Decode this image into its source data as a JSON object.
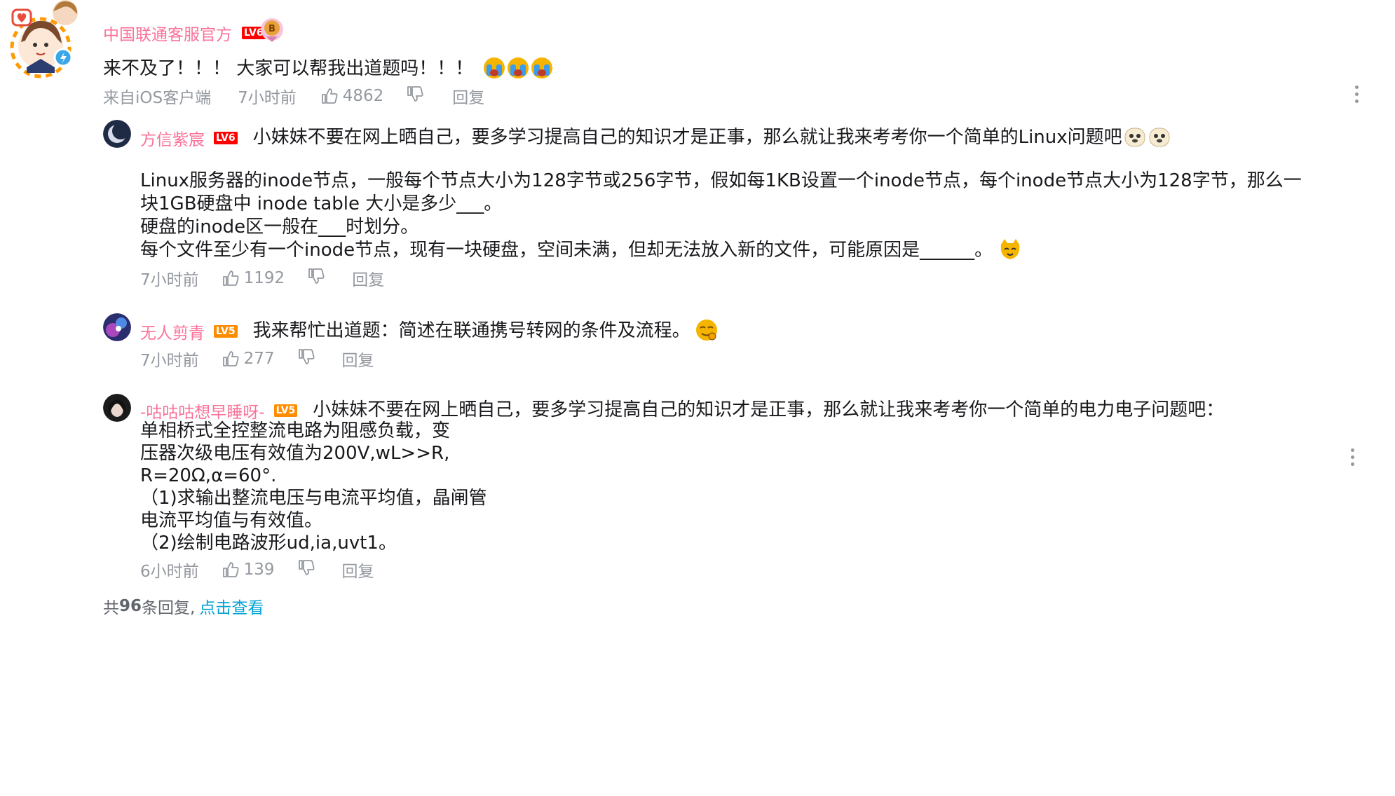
{
  "main_comment": {
    "username": "中国联通客服官方",
    "level": "LV6",
    "text": "来不及了！！！ 大家可以帮我出道题吗！！！",
    "source": "来自iOS客户端",
    "time": "7小时前",
    "likes": "4862",
    "reply_label": "回复"
  },
  "replies": [
    {
      "username": "方信紫宸",
      "level": "LV6",
      "intro": "小妹妹不要在网上晒自己，要多学习提高自己的知识才是正事，那么就让我来考考你一个简单的Linux问题吧",
      "body_lines": [
        "Linux服务器的inode节点，一般每个节点大小为128字节或256字节，假如每1KB设置一个inode节点，每个inode节点大小为128字节，那么一",
        "块1GB硬盘中 inode table 大小是多少___。",
        "硬盘的inode区一般在___时划分。",
        "每个文件至少有一个inode节点，现有一块硬盘，空间未满，但却无法放入新的文件，可能原因是______。"
      ],
      "time": "7小时前",
      "likes": "1192",
      "reply_label": "回复"
    },
    {
      "username": "无人剪青",
      "level": "LV5",
      "intro": "我来帮忙出道题：简述在联通携号转网的条件及流程。",
      "time": "7小时前",
      "likes": "277",
      "reply_label": "回复"
    },
    {
      "username": "-咕咕咕想早睡呀-",
      "level": "LV5",
      "intro": "小妹妹不要在网上晒自己，要多学习提高自己的知识才是正事，那么就让我来考考你一个简单的电力电子问题吧：",
      "body_lines": [
        "单相桥式全控整流电路为阻感负载，变",
        "压器次级电压有效值为200V,wL>>R,",
        "R=20Ω,α=60°.",
        "（1)求输出整流电压与电流平均值，晶闸管",
        "电流平均值与有效值。",
        "（2)绘制电路波形ud,ia,uvt1。"
      ],
      "time": "6小时前",
      "likes": "139",
      "reply_label": "回复"
    }
  ],
  "footer": {
    "prefix": "共",
    "count": "96",
    "suffix": "条回复,",
    "link": "点击查看"
  },
  "colors": {
    "username": "#fb7299",
    "meta": "#9499a0",
    "link": "#00a1d6",
    "text": "#18191c"
  }
}
